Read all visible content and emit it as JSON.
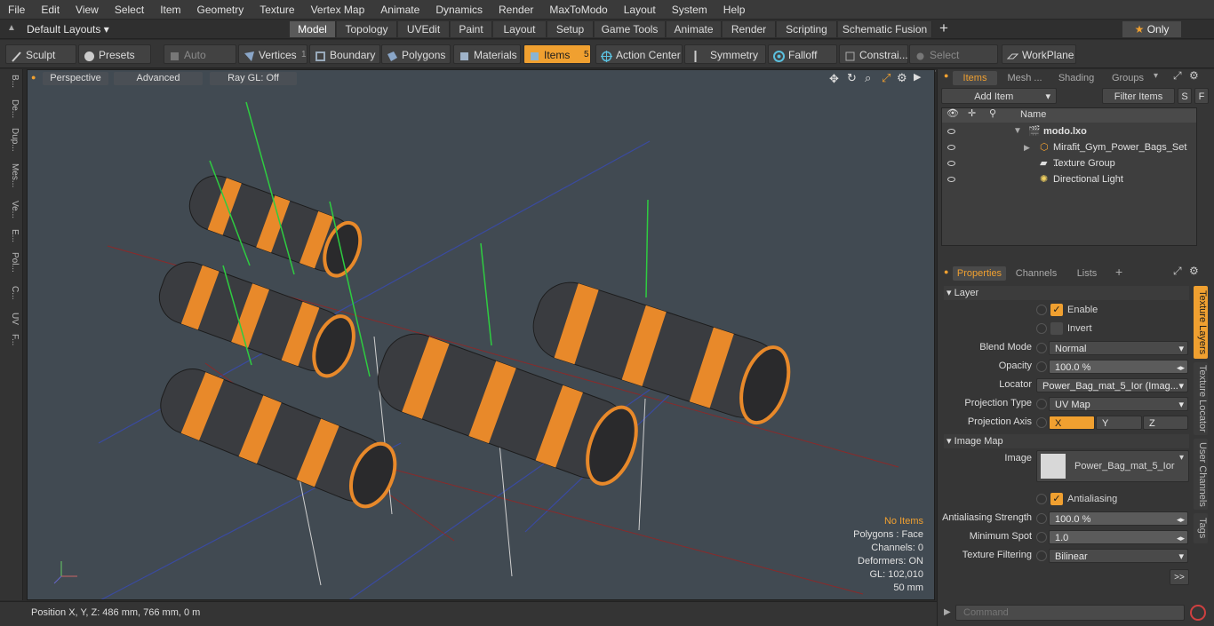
{
  "menu": [
    "File",
    "Edit",
    "View",
    "Select",
    "Item",
    "Geometry",
    "Texture",
    "Vertex Map",
    "Animate",
    "Dynamics",
    "Render",
    "MaxToModo",
    "Layout",
    "System",
    "Help"
  ],
  "layouts_label": "Default Layouts",
  "layout_tabs": [
    "Model",
    "Topology",
    "UVEdit",
    "Paint",
    "Layout",
    "Setup",
    "Game Tools",
    "Animate",
    "Render",
    "Scripting",
    "Schematic Fusion"
  ],
  "only_label": "Only",
  "toolbar": {
    "sculpt": "Sculpt",
    "presets": "Presets",
    "auto_select": "Auto Select",
    "vertices": "Vertices",
    "vertices_count": "1",
    "boundary": "Boundary",
    "polygons": "Polygons",
    "materials": "Materials",
    "items": "Items",
    "items_count": "5",
    "action_center": "Action Center",
    "symmetry": "Symmetry",
    "falloff": "Falloff",
    "constraints": "Constrai...",
    "select_through": "Select Through",
    "workplane": "WorkPlane"
  },
  "left_tabs": [
    "B...",
    "De...",
    "Dup...",
    "Mes...",
    "Ve...",
    "E...",
    "Pol...",
    "C...",
    "UV",
    "F..."
  ],
  "viewport": {
    "view": "Perspective",
    "shading": "Advanced",
    "raygl": "Ray GL: Off",
    "stats": [
      "No Items",
      "Polygons : Face",
      "Channels: 0",
      "Deformers: ON",
      "GL: 102,010",
      "50 mm"
    ]
  },
  "status": "Position X, Y, Z:  486 mm, 766 mm, 0 m",
  "items_panel": {
    "tabs": [
      "Items",
      "Mesh ...",
      "Shading",
      "Groups"
    ],
    "add_item": "Add Item",
    "filter": "Filter Items",
    "s": "S",
    "f": "F",
    "name_col": "Name",
    "rows": [
      "modo.lxo",
      "Mirafit_Gym_Power_Bags_Set ...",
      "Texture Group",
      "Directional Light"
    ]
  },
  "props_panel": {
    "tabs": [
      "Properties",
      "Channels",
      "Lists"
    ],
    "layer_section": "Layer",
    "enable": "Enable",
    "invert": "Invert",
    "blend_label": "Blend Mode",
    "blend": "Normal",
    "opacity_label": "Opacity",
    "opacity": "100.0 %",
    "locator_label": "Locator",
    "locator": "Power_Bag_mat_5_Ior (Imag...",
    "proj_type_label": "Projection Type",
    "proj_type": "UV Map",
    "proj_axis_label": "Projection Axis",
    "axes": [
      "X",
      "Y",
      "Z"
    ],
    "image_map_section": "Image Map",
    "image_label": "Image",
    "image": "Power_Bag_mat_5_Ior",
    "antialias": "Antialiasing",
    "aa_strength_label": "Antialiasing Strength",
    "aa_strength": "100.0 %",
    "min_spot_label": "Minimum Spot",
    "min_spot": "1.0",
    "filter_label": "Texture Filtering",
    "filter": "Bilinear",
    "more": ">>"
  },
  "side_tabs": [
    "Texture Layers",
    "Texture Locator",
    "User Channels",
    "Tags"
  ],
  "command_placeholder": "Command",
  "colors": {
    "accent": "#f0a030",
    "viewport": "#414a52",
    "bag": "#3a3c40",
    "strap": "#e8892a"
  }
}
